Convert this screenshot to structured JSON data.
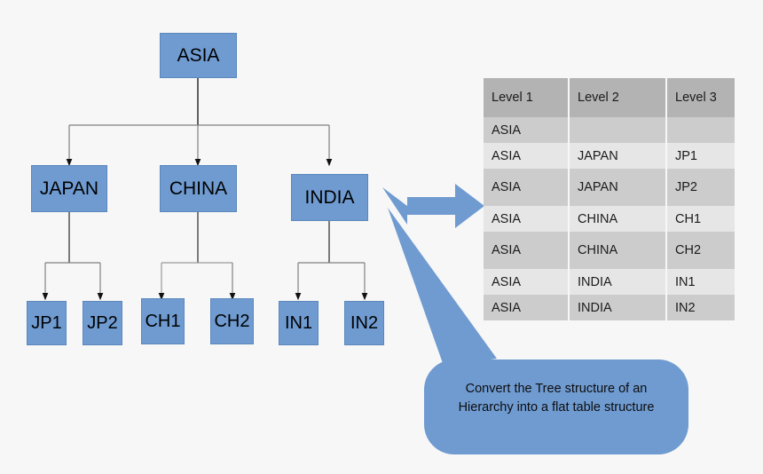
{
  "colors": {
    "background": "#f7f7f7",
    "node_fill": "#6f9bd1",
    "node_stroke": "#5b87bd",
    "connector_line": "#808080",
    "arrowhead": "#000000",
    "table_header_bg": "#b3b3b3",
    "table_row_dark": "#cccccc",
    "table_row_light": "#e6e6e6",
    "callout_fill": "#6f9bd1",
    "text": "#000000"
  },
  "tree": {
    "root": {
      "label": "ASIA"
    },
    "level2": [
      {
        "label": "JAPAN"
      },
      {
        "label": "CHINA"
      },
      {
        "label": "INDIA"
      }
    ],
    "level3": [
      {
        "label": "JP1"
      },
      {
        "label": "JP2"
      },
      {
        "label": "CH1"
      },
      {
        "label": "CH2"
      },
      {
        "label": "IN1"
      },
      {
        "label": "IN2"
      }
    ]
  },
  "table": {
    "headers": [
      "Level 1",
      "Level 2",
      "Level 3"
    ],
    "rows": [
      [
        "ASIA",
        "",
        ""
      ],
      [
        "ASIA",
        "JAPAN",
        "JP1"
      ],
      [
        "ASIA",
        "JAPAN",
        "JP2"
      ],
      [
        "ASIA",
        "CHINA",
        "CH1"
      ],
      [
        "ASIA",
        "CHINA",
        "CH2"
      ],
      [
        "ASIA",
        "INDIA",
        "IN1"
      ],
      [
        "ASIA",
        "INDIA",
        "IN2"
      ]
    ]
  },
  "callout": {
    "line1": "Convert the Tree structure of an",
    "line2": "Hierarchy into a flat table structure"
  }
}
